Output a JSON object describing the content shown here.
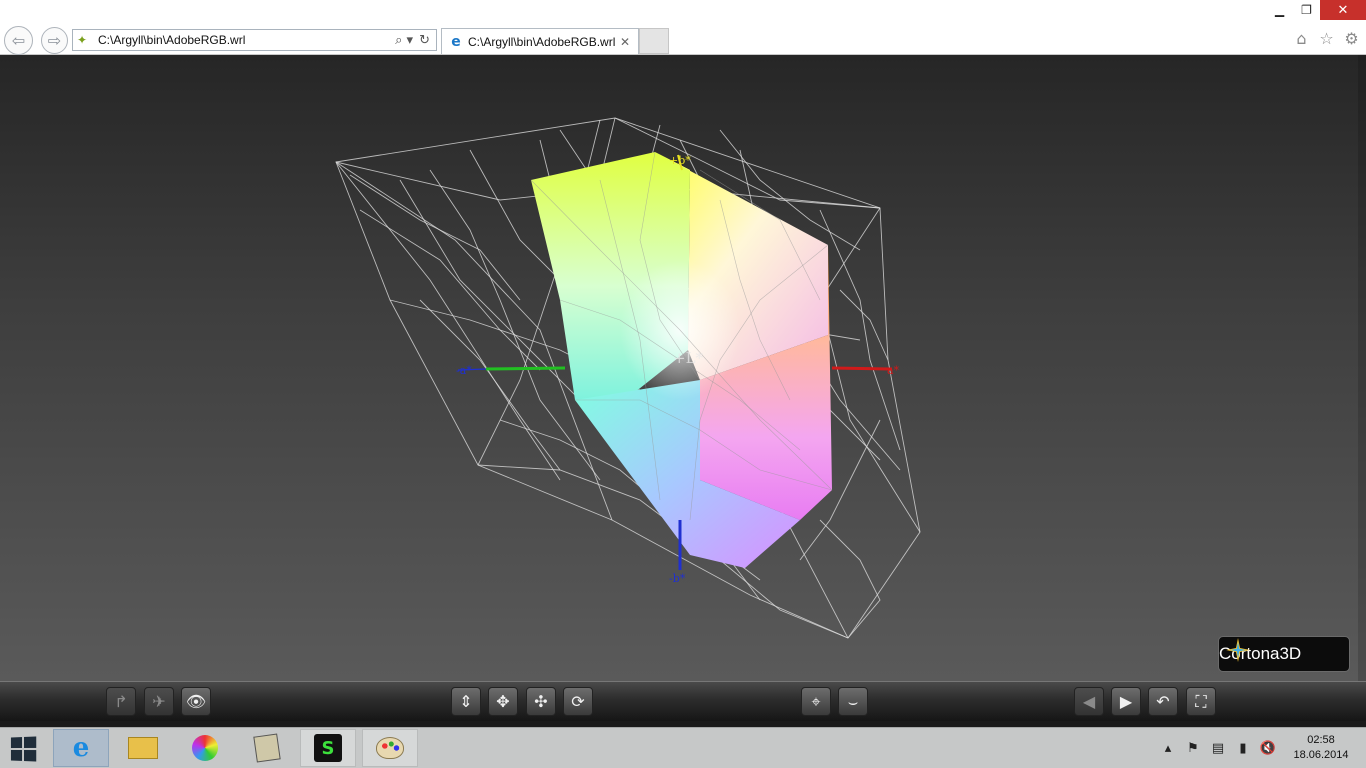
{
  "window": {
    "minimize_icon": "minimize-icon",
    "restore_icon": "restore-icon",
    "close_icon": "close-icon",
    "close_glyph": "✕"
  },
  "address_bar": {
    "url": "C:\\Argyll\\bin\\AdobeRGB.wrl",
    "search_glyph": "⌕ ▾",
    "refresh_glyph": "↻"
  },
  "tab": {
    "title": "C:\\Argyll\\bin\\AdobeRGB.wrl",
    "close_glyph": "✕"
  },
  "toolbar_icons": {
    "home": "home-icon",
    "favorites": "star-icon",
    "settings": "gear-icon"
  },
  "scene": {
    "axis_labels": {
      "plus_b": "+b*",
      "minus_b": "-b*",
      "plus_L": "+L*",
      "plus_a": "a*",
      "minus_a": "-a*"
    },
    "axis_colors": {
      "a_positive": "#d01a1a",
      "a_negative": "#22c022",
      "b_positive": "#e8e020",
      "b_negative": "#2030d0"
    }
  },
  "cortona": {
    "brand": "Cortona3D"
  },
  "viewer_toolbar": {
    "buttons": [
      "go-to-viewpoint-icon",
      "fly-mode-icon",
      "study-mode-icon",
      "plan-icon",
      "pan-icon",
      "turn-icon",
      "roll-icon",
      "goto-icon",
      "align-icon",
      "previous-viewpoint-icon",
      "next-viewpoint-icon",
      "restore-icon",
      "fit-icon"
    ]
  },
  "taskbar": {
    "apps": [
      "internet-explorer",
      "file-explorer",
      "color-app",
      "calibration-app",
      "green-app",
      "paint-app"
    ],
    "clock_time": "02:58",
    "clock_date": "18.06.2014"
  }
}
